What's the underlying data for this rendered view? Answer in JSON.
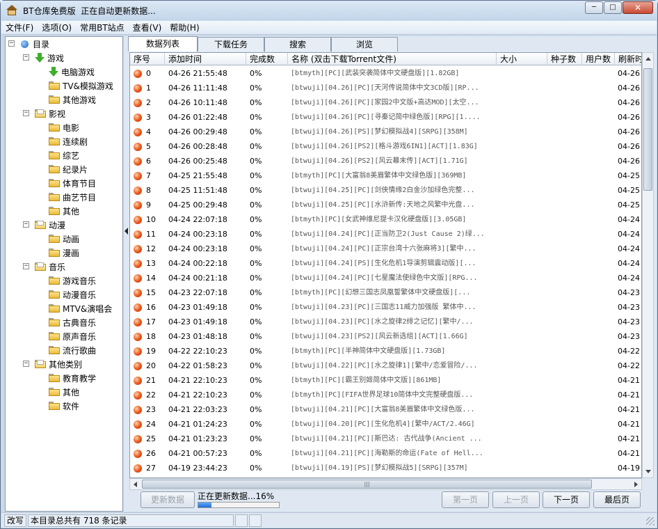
{
  "window": {
    "title": "BT仓库免费版  正在自动更新数据...",
    "controls": {
      "minimize": "─",
      "maximize": "□",
      "close": "✕"
    }
  },
  "menu": [
    "文件(F)",
    "选项(O)",
    "常用BT站点",
    "查看(V)",
    "帮助(H)"
  ],
  "tree": {
    "root": "目录",
    "groups": [
      {
        "label": "游戏",
        "children": [
          "电脑游戏",
          "TV&模拟游戏",
          "其他游戏"
        ]
      },
      {
        "label": "影视",
        "children": [
          "电影",
          "连续剧",
          "综艺",
          "纪录片",
          "体育节目",
          "曲艺节目",
          "其他"
        ]
      },
      {
        "label": "动漫",
        "children": [
          "动画",
          "漫画"
        ]
      },
      {
        "label": "音乐",
        "children": [
          "游戏音乐",
          "动漫音乐",
          "MTV&演唱会",
          "古典音乐",
          "原声音乐",
          "流行歌曲"
        ]
      },
      {
        "label": "其他类别",
        "children": [
          "教育教学",
          "其他",
          "软件"
        ]
      }
    ]
  },
  "tabs": [
    "数据列表",
    "下载任务",
    "搜索",
    "浏览"
  ],
  "columns": [
    "序号",
    "添加时间",
    "完成数",
    "名称 (双击下载Torrent文件)",
    "大小",
    "种子数",
    "用户数",
    "刷新时"
  ],
  "rows": [
    {
      "id": "0",
      "time": "04-26 21:55:48",
      "done": "0%",
      "name": "[btmyth][PC][武装突袭简体中文硬盘版][1.82GB]",
      "refresh": "04-26"
    },
    {
      "id": "1",
      "time": "04-26 11:11:48",
      "done": "0%",
      "name": "[btwuji][04.26][PC][天河传说简体中文3CD版][RP...",
      "refresh": "04-26"
    },
    {
      "id": "2",
      "time": "04-26 10:11:48",
      "done": "0%",
      "name": "[btwuji][04.26][PC][家园2中文版+高达MOD][太空...",
      "refresh": "04-26"
    },
    {
      "id": "3",
      "time": "04-26 01:22:48",
      "done": "0%",
      "name": "[btwuji][04.26][PC][寻秦记简中绿色版][RPG][1....",
      "refresh": "04-26"
    },
    {
      "id": "4",
      "time": "04-26 00:29:48",
      "done": "0%",
      "name": "[btwuji][04.26][PS][梦幻模拟战4][SRPG][358M]",
      "refresh": "04-26"
    },
    {
      "id": "5",
      "time": "04-26 00:28:48",
      "done": "0%",
      "name": "[btwuji][04.26][PS2][格斗游戏6IN1][ACT][1.83G]",
      "refresh": "04-26"
    },
    {
      "id": "6",
      "time": "04-26 00:25:48",
      "done": "0%",
      "name": "[btwuji][04.26][PS2][风云幕末传][ACT][1.71G]",
      "refresh": "04-26"
    },
    {
      "id": "7",
      "time": "04-25 21:55:48",
      "done": "0%",
      "name": "[btmyth][PC][大富翁8美眉繁体中文绿色版][369MB]",
      "refresh": "04-25"
    },
    {
      "id": "8",
      "time": "04-25 11:51:48",
      "done": "0%",
      "name": "[btwuji][04.25][PC][剑侠情缘2白金沙加绿色完整...",
      "refresh": "04-25"
    },
    {
      "id": "9",
      "time": "04-25 00:29:48",
      "done": "0%",
      "name": "[btwuji][04.25][PC][水浒新传:天地之风繁中光盘...",
      "refresh": "04-25"
    },
    {
      "id": "10",
      "time": "04-24 22:07:18",
      "done": "0%",
      "name": "[btmyth][PC][女武神维尼提卡汉化硬盘版][3.05GB]",
      "refresh": "04-24"
    },
    {
      "id": "11",
      "time": "04-24 00:23:18",
      "done": "0%",
      "name": "[btwuji][04.24][PC][正当防卫2(Just Cause 2)绿...",
      "refresh": "04-24"
    },
    {
      "id": "12",
      "time": "04-24 00:23:18",
      "done": "0%",
      "name": "[btwuji][04.24][PC][正宗台湾十六张麻将3][繁中...",
      "refresh": "04-24"
    },
    {
      "id": "13",
      "time": "04-24 00:22:18",
      "done": "0%",
      "name": "[btwuji][04.24][PS][生化危机1导演剪辑震动版][...",
      "refresh": "04-24"
    },
    {
      "id": "14",
      "time": "04-24 00:21:18",
      "done": "0%",
      "name": "[btwuji][04.24][PC][七星魔法使绿色中文版][RPG...",
      "refresh": "04-24"
    },
    {
      "id": "15",
      "time": "04-23 22:07:18",
      "done": "0%",
      "name": "[btmyth][PC][幻想三国志凤凰誓繁体中文硬盘版][...",
      "refresh": "04-23"
    },
    {
      "id": "16",
      "time": "04-23 01:49:18",
      "done": "0%",
      "name": "[btwuji][04.23][PC][三国志11威力加强版 繁体中...",
      "refresh": "04-23"
    },
    {
      "id": "17",
      "time": "04-23 01:49:18",
      "done": "0%",
      "name": "[btwuji][04.23][PC][水之旋律2绯之记忆][繁中/...",
      "refresh": "04-23"
    },
    {
      "id": "18",
      "time": "04-23 01:48:18",
      "done": "0%",
      "name": "[btwuji][04.23][PS2][风云新选组][ACT][1.66G]",
      "refresh": "04-23"
    },
    {
      "id": "19",
      "time": "04-22 22:10:23",
      "done": "0%",
      "name": "[btmyth][PC][半神简体中文硬盘版][1.73GB]",
      "refresh": "04-22"
    },
    {
      "id": "20",
      "time": "04-22 01:58:23",
      "done": "0%",
      "name": "[btwuji][04.22][PC][水之旋律1][繁中/恋爱冒险/...",
      "refresh": "04-22"
    },
    {
      "id": "21",
      "time": "04-21 22:10:23",
      "done": "0%",
      "name": "[btmyth][PC][霸王别姬简体中文版][861MB]",
      "refresh": "04-21"
    },
    {
      "id": "22",
      "time": "04-21 22:10:23",
      "done": "0%",
      "name": "[btmyth][PC][FIFA世界足球10简体中文完整硬盘版...",
      "refresh": "04-21"
    },
    {
      "id": "23",
      "time": "04-21 22:03:23",
      "done": "0%",
      "name": "[btwuji][04.21][PC][大富翁8美眉繁体中文绿色版...",
      "refresh": "04-21"
    },
    {
      "id": "24",
      "time": "04-21 01:24:23",
      "done": "0%",
      "name": "[btwuji][04.20][PC][生化危机4][繁中/ACT/2.46G]",
      "refresh": "04-21"
    },
    {
      "id": "25",
      "time": "04-21 01:23:23",
      "done": "0%",
      "name": "[btwuji][04.21][PC][斯巴达: 古代战争(Ancient ...",
      "refresh": "04-21"
    },
    {
      "id": "26",
      "time": "04-21 00:57:23",
      "done": "0%",
      "name": "[btwuji][04.21][PC][海勒斯的命运(Fate of Hell...",
      "refresh": "04-21"
    },
    {
      "id": "27",
      "time": "04-19 23:44:23",
      "done": "0%",
      "name": "[btwuji][04.19][PS][梦幻模拟战5][SRPG][357M]",
      "refresh": "04-19"
    }
  ],
  "footer": {
    "update_button": "更新数据",
    "progress_text": "正在更新数据...16%",
    "progress_fraction": 0.16,
    "first_page": "第一页",
    "prev_page": "上一页",
    "next_page": "下一页",
    "last_page": "最后页"
  },
  "statusbar": {
    "mode": "改写",
    "message": "本目录总共有 718 条记录"
  },
  "colors": {
    "accent_blue": "#1f6fd8",
    "status_orange": "#e8541a"
  }
}
